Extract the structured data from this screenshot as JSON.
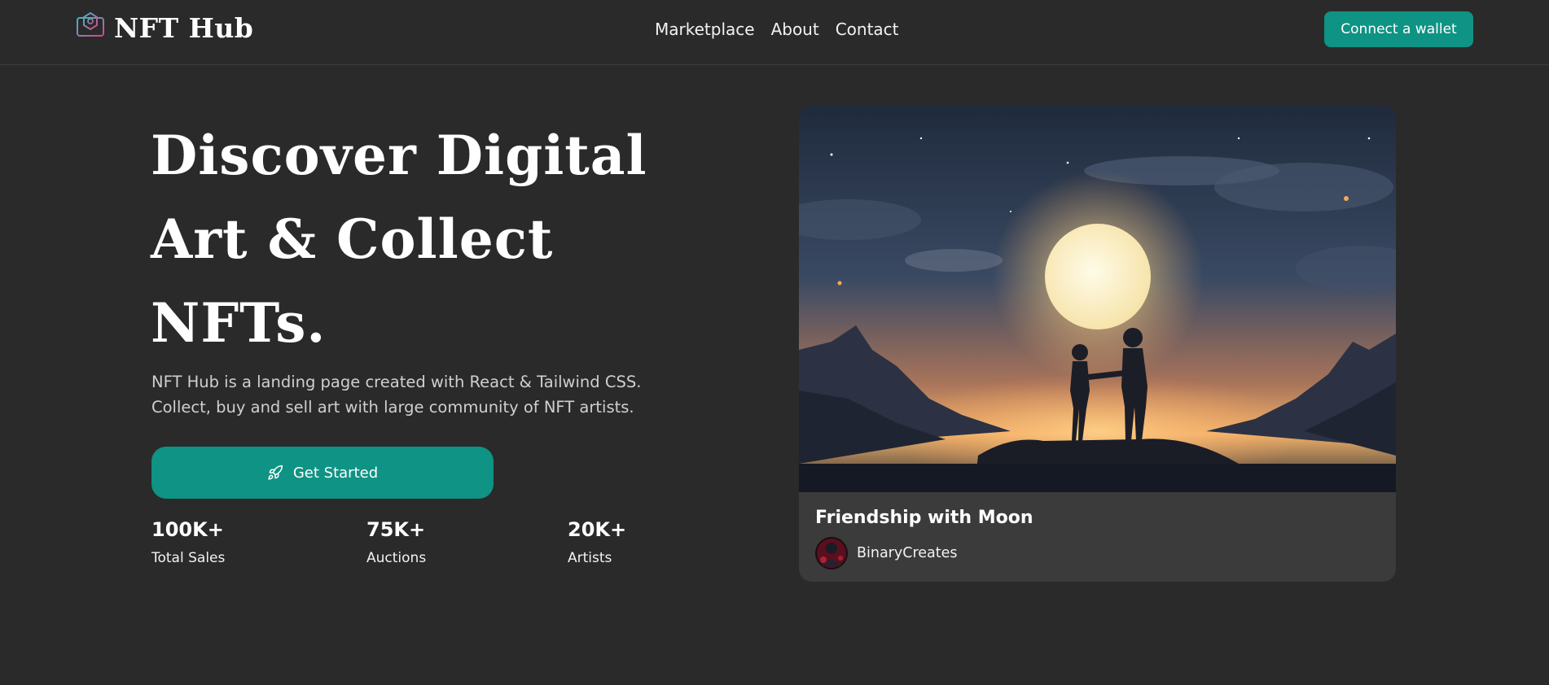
{
  "header": {
    "brand": "NFT Hub",
    "nav": [
      "Marketplace",
      "About",
      "Contact"
    ],
    "wallet_button": "Connect a wallet"
  },
  "hero": {
    "title_lines": [
      "Discover Digital",
      "Art & Collect",
      "NFTs."
    ],
    "description_lines": [
      "NFT Hub is a landing page created with React & Tailwind CSS.",
      "Collect, buy and sell art with large community of NFT artists."
    ],
    "cta_label": "Get Started",
    "cta_icon": "rocket-icon",
    "stats": [
      {
        "value": "100K+",
        "label": "Total Sales"
      },
      {
        "value": "75K+",
        "label": "Auctions"
      },
      {
        "value": "20K+",
        "label": "Artists"
      }
    ]
  },
  "card": {
    "title": "Friendship with Moon",
    "artist": "BinaryCreates"
  },
  "colors": {
    "background": "#2a2a2a",
    "accent": "#0e9384",
    "card": "#3b3b3b"
  }
}
